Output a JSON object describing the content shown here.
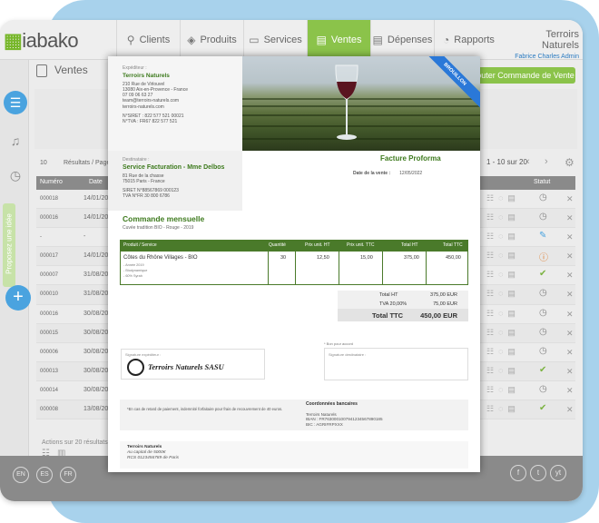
{
  "brand": {
    "logo_text": "iabako"
  },
  "nav": {
    "items": [
      {
        "label": "Clients",
        "icon": "person-icon"
      },
      {
        "label": "Produits",
        "icon": "tag-icon"
      },
      {
        "label": "Services",
        "icon": "briefcase-icon"
      },
      {
        "label": "Ventes",
        "icon": "receipt-icon",
        "active": true
      },
      {
        "label": "Dépenses",
        "icon": "document-icon"
      },
      {
        "label": "Rapports",
        "icon": "chart-icon"
      }
    ]
  },
  "account": {
    "company": "Terroirs Naturels",
    "user": "Fabrice Charles Admin"
  },
  "colors": {
    "accent": "#8bc34a",
    "blue": "#4aa3df",
    "green_text": "#3d7a1d",
    "ribbon": "#2a78d8"
  },
  "page": {
    "title": "Ventes",
    "add_button": "Ajouter Commande de Vente"
  },
  "sidebar": {
    "feedback_tab": "Proposez une idée"
  },
  "pagination": {
    "per_page": "10",
    "per_page_label": "Résultats / Page",
    "info": "1 - 10 sur 20"
  },
  "table": {
    "headers": {
      "number": "Numéro",
      "date": "Date",
      "status": "Statut"
    },
    "rows": [
      {
        "number": "000018",
        "date": "14/01/20",
        "status": "clock"
      },
      {
        "number": "000016",
        "date": "14/01/20",
        "status": "clock"
      },
      {
        "number": "-",
        "date": "-",
        "status": "edit"
      },
      {
        "number": "000017",
        "date": "14/01/20",
        "status": "alert"
      },
      {
        "number": "000007",
        "date": "31/08/20",
        "status": "check"
      },
      {
        "number": "000010",
        "date": "31/08/20",
        "status": "clock"
      },
      {
        "number": "000016",
        "date": "30/08/20",
        "status": "clock"
      },
      {
        "number": "000015",
        "date": "30/08/20",
        "status": "clock"
      },
      {
        "number": "000006",
        "date": "30/08/20",
        "status": "clock"
      },
      {
        "number": "000013",
        "date": "30/08/20",
        "status": "check"
      },
      {
        "number": "000014",
        "date": "30/08/20",
        "status": "clock"
      },
      {
        "number": "000008",
        "date": "13/08/20",
        "status": "check"
      }
    ]
  },
  "summary": {
    "actions": "Actions sur 20 résultats"
  },
  "footer": {
    "languages": [
      "EN",
      "ES",
      "FR"
    ],
    "social": [
      "f",
      "t",
      "yt"
    ]
  },
  "invoice": {
    "ribbon": "BROUILLON",
    "seller": {
      "label": "Expéditeur :",
      "name": "Terroirs Naturels",
      "lines": [
        "210 Rue de Virlouvel",
        "13080 Aix-en-Provence - France",
        "07 09 06 63 27",
        "team@terroirs-naturels.com",
        "terroirs-naturels.com"
      ],
      "ids": [
        "N°SIRET : 822 577 521 00021",
        "N°TVA : FR67 822 577 521"
      ]
    },
    "recipient": {
      "label": "Destinataire :",
      "name": "Service Facturation - Mme Delbos",
      "lines": [
        "81 Rue de la chasse",
        "75015 Paris - France"
      ],
      "ids": [
        "SIRET N°88567869 000123",
        "TVA N°FR 30 800 6786"
      ]
    },
    "title": "Facture Proforma",
    "date_label": "Date de la vente :",
    "date_value": "12/05/2022",
    "order_title": "Commande mensuelle",
    "order_sub": "Cuvée tradition BIO - Rouge - 2019",
    "columns": [
      "Produit / Service",
      "Quantité",
      "Prix unit. HT",
      "Prix unit. TTC",
      "Total HT",
      "Total TTC"
    ],
    "item": {
      "name": "Côtes du Rhône Villages - BIO",
      "details": [
        "- Année 2019",
        "- Biodynamique",
        "- 60% Syrah"
      ],
      "qty": "30",
      "unit_ht": "12,50",
      "unit_ttc": "15,00",
      "total_ht": "375,00",
      "total_ttc": "450,00"
    },
    "totals": {
      "ht_label": "Total HT",
      "ht_value": "375,00 EUR",
      "tva_label": "TVA 20,00%",
      "tva_value": "75,00 EUR",
      "ttc_label": "Total TTC",
      "ttc_value": "450,00 EUR"
    },
    "sig_label": "Signature expéditeur :",
    "stamp": "Terroirs Naturels SASU",
    "bon_label": "* Bon pour accord",
    "bon_sig_label": "Signature destinataire :",
    "legal": "*En cas de retard de paiement, indemnité forfaitaire pour frais de recouvrement de 40 euros.",
    "bank": {
      "title": "Coordonnées bancaires",
      "name": "Terroirs Naturels",
      "iban": "IBAN : FR7630001007941234567890185",
      "bic": "BIC : AGRIFRPXXX"
    },
    "company": {
      "name": "Terroirs Naturels",
      "capital": "Au capital de 5000€",
      "rcs": "RCS 0123456789 de Paris"
    }
  }
}
